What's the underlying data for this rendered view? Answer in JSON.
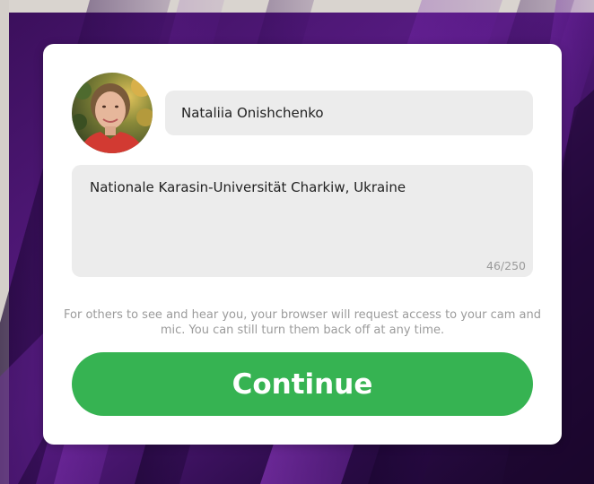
{
  "colors": {
    "card_background": "#ffffff",
    "field_background": "#ececec",
    "button_green": "#36b352",
    "button_text": "#ffffff",
    "muted_text": "#9b9b9b",
    "background_purple": "#4a1670"
  },
  "profile": {
    "avatar_icon": "user-photo",
    "name_value": "Nataliia Onishchenko",
    "bio_value": "Nationale Karasin-Universität Charkiw, Ukraine",
    "bio_counter": "46/250"
  },
  "notice": {
    "text": "For others to see and hear you, your browser will request access to your cam and mic. You can still turn them back off at any time."
  },
  "actions": {
    "continue_label": "Continue"
  }
}
